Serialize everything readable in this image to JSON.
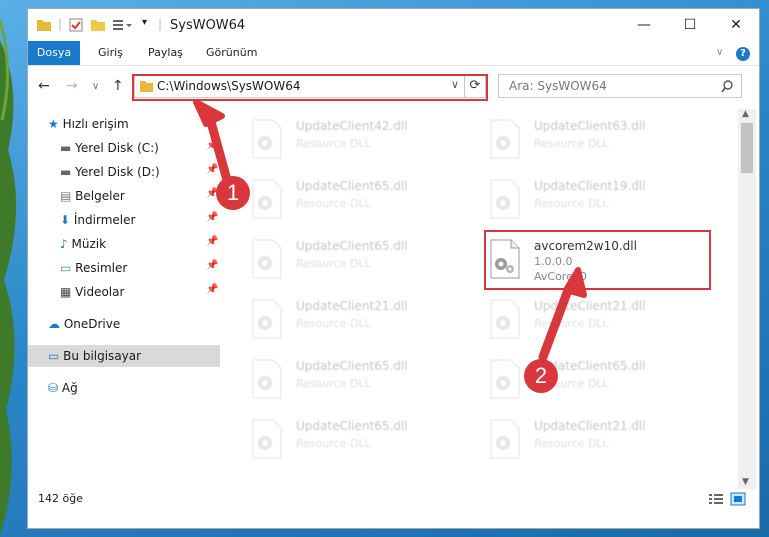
{
  "window": {
    "title": "SysWOW64"
  },
  "ribbon": {
    "tabs": [
      "Dosya",
      "Giriş",
      "Paylaş",
      "Görünüm"
    ]
  },
  "navbar": {
    "address": "C:\\Windows\\SysWOW64",
    "search_placeholder": "Ara: SysWOW64"
  },
  "sidebar": {
    "quick_access": "Hızlı erişim",
    "items": [
      "Yerel Disk (C:)",
      "Yerel Disk (D:)",
      "Belgeler",
      "İndirmeler",
      "Müzik",
      "Resimler",
      "Videolar"
    ],
    "onedrive": "OneDrive",
    "this_pc": "Bu bilgisayar",
    "network": "Ağ"
  },
  "files": {
    "left": [
      {
        "name": "UpdateClient42.dll",
        "type": "Resource DLL"
      },
      {
        "name": "UpdateClient65.dll",
        "type": "Resource DLL"
      },
      {
        "name": "UpdateClient65.dll",
        "type": "Resource DLL"
      },
      {
        "name": "UpdateClient21.dll",
        "type": "Resource DLL"
      },
      {
        "name": "UpdateClient65.dll",
        "type": "Resource DLL"
      },
      {
        "name": "UpdateClient65.dll",
        "type": "Resource DLL"
      }
    ],
    "right": [
      {
        "name": "UpdateClient63.dll",
        "type": "Resource DLL"
      },
      {
        "name": "UpdateClient19.dll",
        "type": "Resource DLL"
      },
      {
        "name": "avcorem2w10.dll",
        "version": "1.0.0.0",
        "company": "AvCore10"
      },
      {
        "name": "UpdateClient21.dll",
        "type": "Resource DLL"
      },
      {
        "name": "UpdateClient65.dll",
        "type": "Resource DLL"
      },
      {
        "name": "UpdateClient21.dll",
        "type": "Resource DLL"
      }
    ]
  },
  "status": {
    "count": "142 öğe"
  },
  "annotations": {
    "badge1": "1",
    "badge2": "2"
  },
  "colors": {
    "accent": "#1979ca",
    "highlight": "#d8373c",
    "selection": "#cce8ff"
  }
}
